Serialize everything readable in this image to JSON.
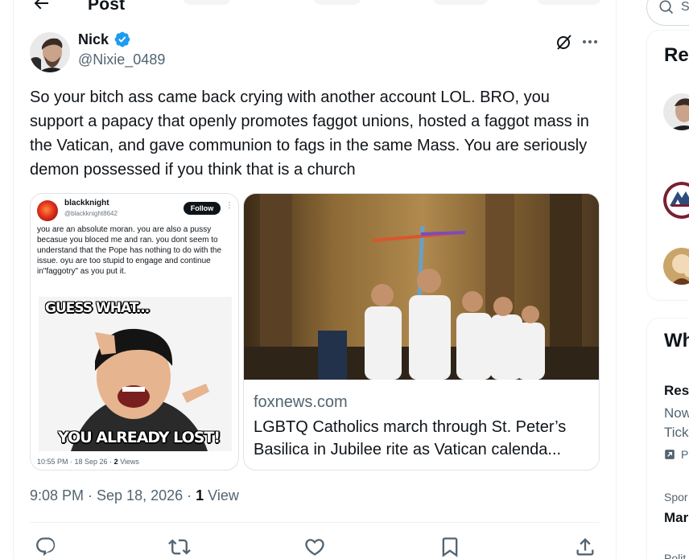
{
  "header": {
    "title": "Post"
  },
  "author": {
    "name": "Nick",
    "handle": "@Nixie_0489"
  },
  "tweet": {
    "text": "So your bitch ass came back crying with another account LOL. BRO, you support a papacy that openly promotes faggot unions, hosted a faggot mass in the Vatican, and gave communion to fags in the same Mass. You are seriously demon possessed if you think that is a church"
  },
  "screenshot": {
    "name": "blackknight",
    "handle": "@blackknight8642",
    "follow_label": "Follow",
    "text": "you are an absolute moran. you are also a pussy becasue you bloced me and ran. you dont seem to understand that the Pope has nothing to do with the issue.  oyu are too stupid to engage and continue in\"faggotry\" as you put it.",
    "meme_top": "GUESS WHAT...",
    "meme_bottom": "YOU ALREADY LOST!",
    "meta_time": "10:55 PM · 18 Sep 26 · ",
    "meta_views_count": "2",
    "meta_views_label": " Views"
  },
  "link_card": {
    "domain": "foxnews.com",
    "title": "LGBTQ Catholics march through St. Peter’s Basilica in Jubilee rite as Vatican calenda..."
  },
  "meta": {
    "time": "9:08 PM · Sep 18, 2026 · ",
    "views_count": "1",
    "views_label": " View"
  },
  "actions": [
    "reply",
    "repost",
    "like",
    "bookmark",
    "share"
  ],
  "sidebar": {
    "search_placeholder": "S",
    "panel1_title": "Re",
    "panel2_title": "Wh",
    "trend_label": "Res",
    "trend_line1": "Now",
    "trend_line2": "Tick",
    "trend_promo": "P",
    "sponsor_label": "Spor",
    "sponsor_name": "Mar",
    "politics_label": "Polit"
  },
  "colors": {
    "accent": "#1d9bf0",
    "text": "#0f1419",
    "muted": "#536471",
    "border": "#eff3f4"
  }
}
